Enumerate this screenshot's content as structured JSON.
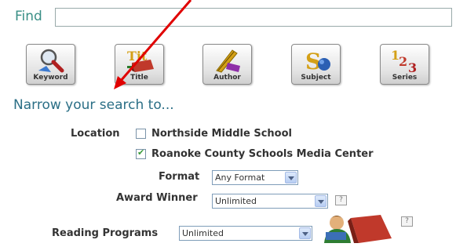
{
  "find": {
    "label": "Find",
    "value": ""
  },
  "search_buttons": [
    {
      "label": "Keyword",
      "icon": "magnifier-icon"
    },
    {
      "label": "Title",
      "icon": "book-icon"
    },
    {
      "label": "Author",
      "icon": "quill-icon"
    },
    {
      "label": "Subject",
      "icon": "subject-icon"
    },
    {
      "label": "Series",
      "icon": "series-123-icon"
    }
  ],
  "narrow": {
    "heading": "Narrow your search to..."
  },
  "location": {
    "label": "Location",
    "options": [
      {
        "label": "Northside Middle School",
        "checked": false
      },
      {
        "label": "Roanoke County Schools Media Center",
        "checked": true
      }
    ]
  },
  "format": {
    "label": "Format",
    "value": "Any Format"
  },
  "award": {
    "label": "Award Winner",
    "value": "Unlimited",
    "help": "?"
  },
  "reading": {
    "label": "Reading Programs",
    "value": "Unlimited",
    "help": "?"
  },
  "colors": {
    "accent": "#3a8f86",
    "heading": "#2b6f86",
    "annotation_arrow": "#e00000"
  }
}
